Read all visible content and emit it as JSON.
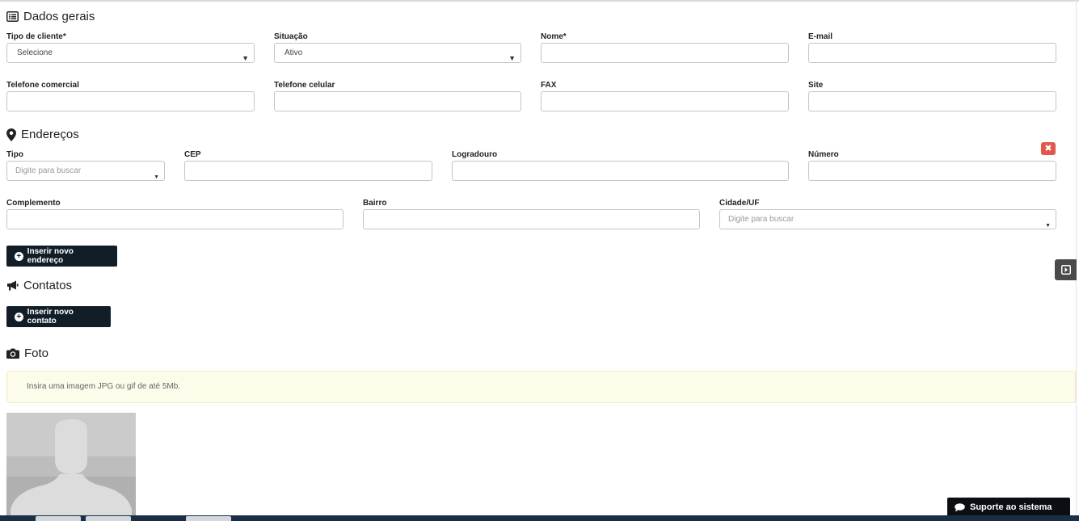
{
  "sections": {
    "dados_gerais": "Dados gerais",
    "enderecos": "Endereços",
    "contatos": "Contatos",
    "foto": "Foto"
  },
  "dados_gerais": {
    "tipo_cliente": {
      "label": "Tipo de cliente*",
      "value": "Selecione"
    },
    "situacao": {
      "label": "Situação",
      "value": "Ativo"
    },
    "nome": {
      "label": "Nome*",
      "value": ""
    },
    "email": {
      "label": "E-mail",
      "value": ""
    },
    "telefone_comercial": {
      "label": "Telefone comercial",
      "value": ""
    },
    "telefone_celular": {
      "label": "Telefone celular",
      "value": ""
    },
    "fax": {
      "label": "FAX",
      "value": ""
    },
    "site": {
      "label": "Site",
      "value": ""
    }
  },
  "enderecos": {
    "tipo": {
      "label": "Tipo",
      "placeholder": "Digite para buscar"
    },
    "cep": {
      "label": "CEP",
      "value": ""
    },
    "logradouro": {
      "label": "Logradouro",
      "value": ""
    },
    "numero": {
      "label": "Número",
      "value": ""
    },
    "complemento": {
      "label": "Complemento",
      "value": ""
    },
    "bairro": {
      "label": "Bairro",
      "value": ""
    },
    "cidade_uf": {
      "label": "Cidade/UF",
      "placeholder": "Digite para buscar"
    },
    "remove_label": "✖",
    "insert_button": "Inserir novo endereço"
  },
  "contatos": {
    "insert_button": "Inserir novo contato"
  },
  "foto": {
    "hint": "Insira uma imagem JPG ou gif de até 5Mb."
  },
  "support_button": "Suporte ao sistema",
  "colors": {
    "button_bg": "#111e28",
    "danger": "#e2574c",
    "alert_bg": "#fdfbe9"
  },
  "icons": [
    "list-icon",
    "map-marker-icon",
    "bullhorn-icon",
    "camera-icon",
    "plus-circle-icon",
    "close-icon",
    "expand-icon",
    "chat-icon",
    "user-placeholder-icon"
  ]
}
